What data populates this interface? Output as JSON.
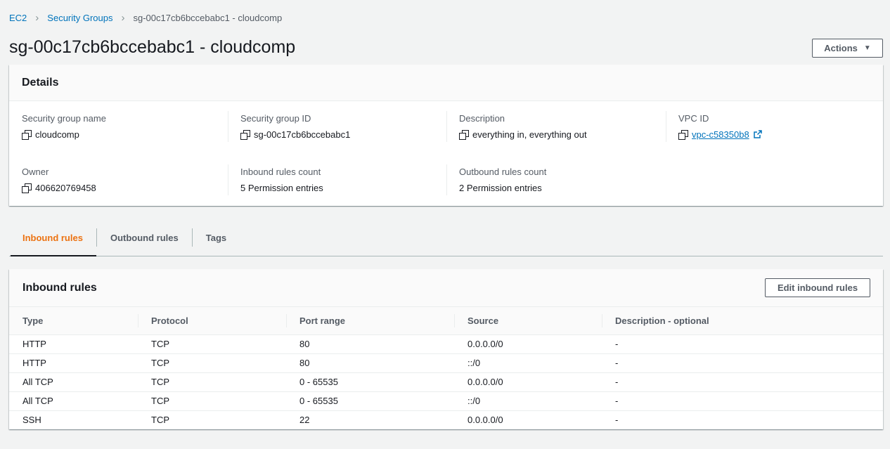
{
  "breadcrumb": {
    "items": [
      "EC2",
      "Security Groups"
    ],
    "current": "sg-00c17cb6bccebabc1 - cloudcomp"
  },
  "page": {
    "title": "sg-00c17cb6bccebabc1 - cloudcomp",
    "actions_label": "Actions"
  },
  "details": {
    "title": "Details",
    "fields": {
      "sg_name": {
        "label": "Security group name",
        "value": "cloudcomp"
      },
      "sg_id": {
        "label": "Security group ID",
        "value": "sg-00c17cb6bccebabc1"
      },
      "description": {
        "label": "Description",
        "value": "everything in, everything out"
      },
      "vpc_id": {
        "label": "VPC ID",
        "value": "vpc-c58350b8"
      },
      "owner": {
        "label": "Owner",
        "value": "406620769458"
      },
      "inbound_count": {
        "label": "Inbound rules count",
        "value": "5 Permission entries"
      },
      "outbound_count": {
        "label": "Outbound rules count",
        "value": "2 Permission entries"
      }
    }
  },
  "tabs": {
    "inbound": "Inbound rules",
    "outbound": "Outbound rules",
    "tags": "Tags",
    "active": "inbound"
  },
  "inbound_rules": {
    "title": "Inbound rules",
    "edit_label": "Edit inbound rules",
    "columns": [
      "Type",
      "Protocol",
      "Port range",
      "Source",
      "Description - optional"
    ],
    "rows": [
      [
        "HTTP",
        "TCP",
        "80",
        "0.0.0.0/0",
        "-"
      ],
      [
        "HTTP",
        "TCP",
        "80",
        "::/0",
        "-"
      ],
      [
        "All TCP",
        "TCP",
        "0 - 65535",
        "0.0.0.0/0",
        "-"
      ],
      [
        "All TCP",
        "TCP",
        "0 - 65535",
        "::/0",
        "-"
      ],
      [
        "SSH",
        "TCP",
        "22",
        "0.0.0.0/0",
        "-"
      ]
    ]
  },
  "colors": {
    "link": "#0073bb",
    "active_tab": "#ec7211",
    "text": "#16191f",
    "muted": "#545b64"
  },
  "icons": {
    "copy": "copy-icon",
    "external_link": "external-link-icon",
    "breadcrumb_separator": "chevron-right-icon",
    "dropdown": "caret-down-icon"
  }
}
